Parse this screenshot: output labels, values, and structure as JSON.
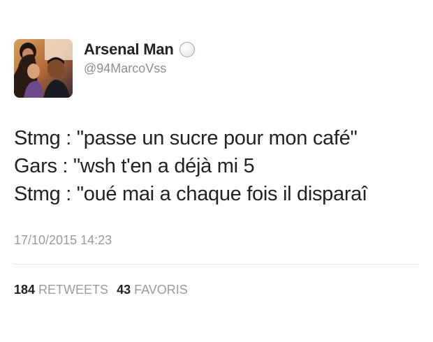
{
  "user": {
    "display_name": "Arsenal Man",
    "handle": "@94MarcoVss",
    "avatar_icon": "profile-photo",
    "badge_icon": "circle-badge-icon"
  },
  "tweet": {
    "lines": [
      "Stmg : \"passe un sucre pour mon café\"",
      "Gars : \"wsh t'en a déjà mi 5",
      "Stmg : \"oué mai a chaque fois il disparaî"
    ],
    "timestamp": "17/10/2015 14:23"
  },
  "stats": {
    "retweets_count": "184",
    "retweets_label": "RETWEETS",
    "favoris_count": "43",
    "favoris_label": "FAVORIS"
  },
  "colors": {
    "text": "#222222",
    "muted": "#9a9a9f",
    "divider": "#e6e6e9",
    "background": "#ffffff"
  }
}
